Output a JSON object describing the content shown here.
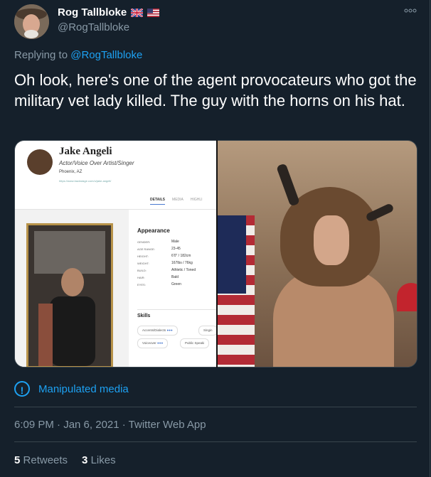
{
  "author": {
    "name": "Rog Tallbloke",
    "handle": "@RogTallbloke",
    "flags": [
      "uk-flag-icon",
      "us-flag-icon"
    ]
  },
  "reply": {
    "prefix": "Replying to ",
    "to": "@RogTallbloke"
  },
  "tweet": {
    "text": "Oh look, here's one of the agent provocateurs who got the military vet lady killed. The guy with the horns on his hat."
  },
  "media": {
    "profile": {
      "name": "Jake Angeli",
      "role": "Actor/Voice Over Artist/Singer",
      "location": "Phoenix, AZ",
      "url": "https://www.backstage.com/u/jake-angeli/",
      "tabs": [
        "DETAILS",
        "MEDIA",
        "HIGHLI"
      ],
      "appearance_heading": "Appearance",
      "appearance": [
        {
          "key": "GENDER:",
          "value": "Male"
        },
        {
          "key": "AGE RANGE:",
          "value": "23-45"
        },
        {
          "key": "HEIGHT:",
          "value": "6'0\" / 182cm"
        },
        {
          "key": "WEIGHT:",
          "value": "167lbs / 76kg"
        },
        {
          "key": "BUILD:",
          "value": "Athletic / Toned"
        },
        {
          "key": "HAIR:",
          "value": "Bald"
        },
        {
          "key": "EYES:",
          "value": "Green"
        }
      ],
      "skills_heading": "Skills",
      "skills": [
        "Accents/Dialects",
        "Singin",
        "Voiceover",
        "Public Speaki"
      ]
    }
  },
  "notice": {
    "label": "Manipulated media"
  },
  "meta": {
    "timestamp": "6:09 PM · Jan 6, 2021 · Twitter Web App"
  },
  "stats": {
    "retweets_count": "5",
    "retweets_label": "Retweets",
    "likes_count": "3",
    "likes_label": "Likes"
  },
  "colors": {
    "background": "#15202b",
    "accent": "#1da1f2",
    "secondary_text": "#8899a6"
  }
}
